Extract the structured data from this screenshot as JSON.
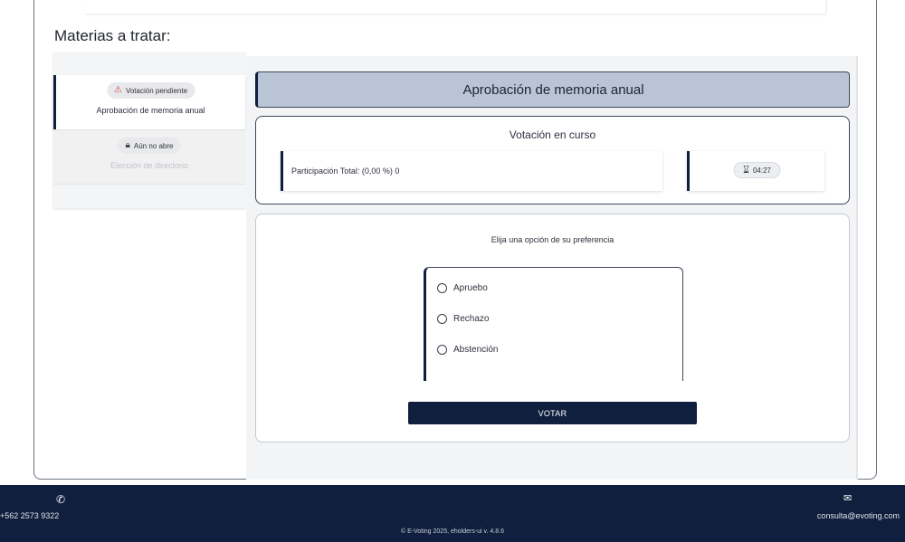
{
  "section": {
    "title": "Materias a tratar:"
  },
  "sidebar": {
    "items": [
      {
        "badge_icon": "warning-icon",
        "badge": "Votación pendiente",
        "title": "Aprobación de memoria anual",
        "state": "active"
      },
      {
        "badge_icon": "lock-icon",
        "badge": "Aún no abre",
        "title": "Elección de directorio",
        "state": "disabled"
      }
    ]
  },
  "main": {
    "header": "Aprobación de memoria anual",
    "status": {
      "title": "Votación en curso",
      "participation": "Participación Total: (0,00 %) 0",
      "timer_icon": "hourglass-icon",
      "timer": "04:27"
    },
    "vote": {
      "prompt": "Elija una opción de su preferencia",
      "options": [
        "Apruebo",
        "Rechazo",
        "Abstención"
      ],
      "button": "VOTAR"
    }
  },
  "footer": {
    "phone_icon": "phone-icon",
    "phone": "+562 2573 9322",
    "mail_icon": "mail-icon",
    "email": "consulta@evoting.com",
    "copyright": "© E-Voting 2025, eholders-ui v. 4.8.6"
  },
  "colors": {
    "navy": "#0f1f3d",
    "header_bg": "#b9c5d6",
    "warning": "#d33b3b"
  }
}
